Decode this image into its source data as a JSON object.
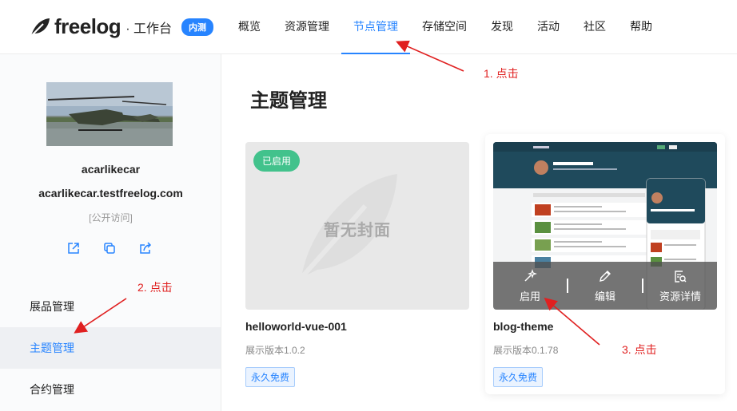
{
  "header": {
    "logo_text": "freelog",
    "logo_sub": "· 工作台",
    "beta_badge": "内测",
    "nav": [
      {
        "label": "概览"
      },
      {
        "label": "资源管理"
      },
      {
        "label": "节点管理"
      },
      {
        "label": "存储空间"
      },
      {
        "label": "发现"
      },
      {
        "label": "活动"
      },
      {
        "label": "社区"
      },
      {
        "label": "帮助"
      }
    ],
    "active_nav": "节点管理"
  },
  "sidebar": {
    "node_name": "acarlikecar",
    "node_domain": "acarlikecar.testfreelog.com",
    "access": "[公开访问]",
    "actions": [
      {
        "icon": "open-external-icon"
      },
      {
        "icon": "copy-icon"
      },
      {
        "icon": "share-icon"
      }
    ],
    "menu": [
      {
        "label": "展品管理"
      },
      {
        "label": "主题管理"
      },
      {
        "label": "合约管理"
      }
    ],
    "active_menu": "主题管理"
  },
  "main": {
    "title": "主题管理",
    "themes": [
      {
        "name": "helloworld-vue-001",
        "version": "展示版本1.0.2",
        "policy": "永久免费",
        "status": "已启用",
        "empty_cover": "暂无封面"
      },
      {
        "name": "blog-theme",
        "version": "展示版本0.1.78",
        "policy": "永久免费",
        "actions": [
          {
            "label": "启用",
            "icon": "magic-wand-icon"
          },
          {
            "label": "编辑",
            "icon": "pencil-icon"
          },
          {
            "label": "资源详情",
            "icon": "resource-detail-icon"
          }
        ]
      }
    ]
  },
  "annotations": [
    {
      "text": "1. 点击"
    },
    {
      "text": "2. 点击"
    },
    {
      "text": "3. 点击"
    }
  ],
  "colors": {
    "accent": "#2784ff",
    "active_tag": "#42c28c",
    "annotation": "#e02020"
  }
}
